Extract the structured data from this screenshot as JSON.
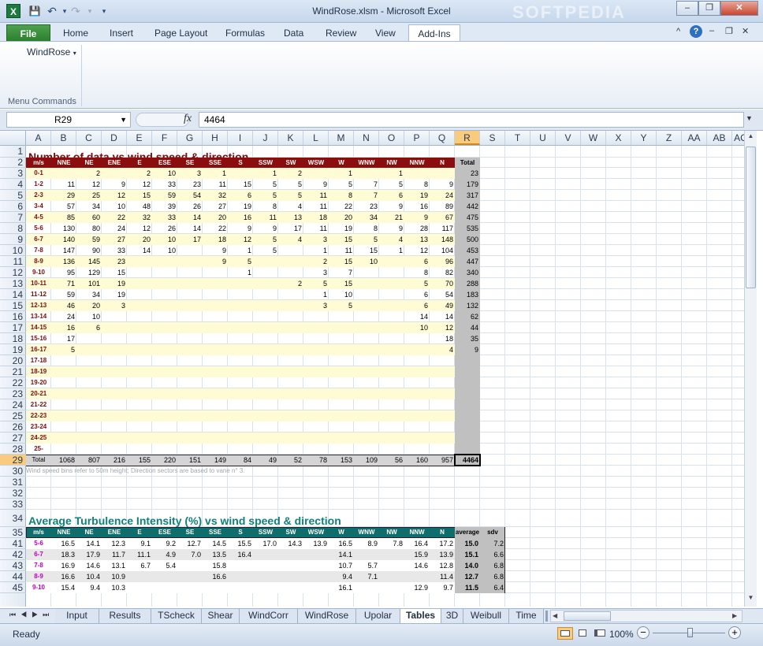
{
  "window": {
    "title": "WindRose.xlsm  -  Microsoft Excel",
    "minimize": "–",
    "restore": "❐",
    "close": "✕",
    "doc_min": "–",
    "doc_restore": "❐",
    "doc_close": "✕",
    "watermark": "SOFTPEDIA"
  },
  "quick_access": {
    "app_icon": "X",
    "save": "💾",
    "undo": "↶",
    "redo": "↷",
    "dropdown": "▾",
    "customize": "▾"
  },
  "ribbon": {
    "tabs": [
      "File",
      "Home",
      "Insert",
      "Page Layout",
      "Formulas",
      "Data",
      "Review",
      "View",
      "Add-Ins"
    ],
    "active_tab": "Add-Ins",
    "windrose_menu": "WindRose",
    "group_label": "Menu Commands",
    "collapse_icon": "^",
    "help_icon": "?"
  },
  "formula_bar": {
    "name_box": "R29",
    "fx": "fx",
    "value": "4464"
  },
  "columns": [
    "A",
    "B",
    "C",
    "D",
    "E",
    "F",
    "G",
    "H",
    "I",
    "J",
    "K",
    "L",
    "M",
    "N",
    "O",
    "P",
    "Q",
    "R",
    "S",
    "T",
    "U",
    "V",
    "W",
    "X",
    "Y",
    "Z",
    "AA",
    "AB",
    "AC"
  ],
  "selected_column": "R",
  "rows": [
    "1",
    "2",
    "3",
    "4",
    "5",
    "6",
    "7",
    "8",
    "9",
    "10",
    "11",
    "12",
    "13",
    "14",
    "15",
    "16",
    "17",
    "18",
    "19",
    "20",
    "21",
    "22",
    "23",
    "24",
    "25",
    "26",
    "27",
    "28",
    "29",
    "30",
    "31",
    "32",
    "33",
    "34",
    "35",
    "41",
    "42",
    "43",
    "44",
    "45"
  ],
  "selected_row": "29",
  "table1": {
    "title": "Number of data vs wind speed & direction",
    "headers": [
      "m/s",
      "NNE",
      "NE",
      "ENE",
      "E",
      "ESE",
      "SE",
      "SSE",
      "S",
      "SSW",
      "SW",
      "WSW",
      "W",
      "WNW",
      "NW",
      "NNW",
      "N",
      "Total"
    ],
    "rows": [
      [
        "0-1",
        "",
        "2",
        "",
        "2",
        "10",
        "3",
        "1",
        "",
        "1",
        "2",
        "",
        "1",
        "",
        "1",
        "",
        "",
        "23"
      ],
      [
        "1-2",
        "11",
        "12",
        "9",
        "12",
        "33",
        "23",
        "11",
        "15",
        "5",
        "5",
        "9",
        "5",
        "7",
        "5",
        "8",
        "9",
        "179"
      ],
      [
        "2-3",
        "29",
        "25",
        "12",
        "15",
        "59",
        "54",
        "32",
        "6",
        "5",
        "5",
        "11",
        "8",
        "7",
        "6",
        "19",
        "24",
        "317"
      ],
      [
        "3-4",
        "57",
        "34",
        "10",
        "48",
        "39",
        "26",
        "27",
        "19",
        "8",
        "4",
        "11",
        "22",
        "23",
        "9",
        "16",
        "89",
        "442"
      ],
      [
        "4-5",
        "85",
        "60",
        "22",
        "32",
        "33",
        "14",
        "20",
        "16",
        "11",
        "13",
        "18",
        "20",
        "34",
        "21",
        "9",
        "67",
        "475"
      ],
      [
        "5-6",
        "130",
        "80",
        "24",
        "12",
        "26",
        "14",
        "22",
        "9",
        "9",
        "17",
        "11",
        "19",
        "8",
        "9",
        "28",
        "117",
        "535"
      ],
      [
        "6-7",
        "140",
        "59",
        "27",
        "20",
        "10",
        "17",
        "18",
        "12",
        "5",
        "4",
        "3",
        "15",
        "5",
        "4",
        "13",
        "148",
        "500"
      ],
      [
        "7-8",
        "147",
        "90",
        "33",
        "14",
        "10",
        "",
        "9",
        "1",
        "5",
        "",
        "1",
        "11",
        "15",
        "1",
        "12",
        "104",
        "453"
      ],
      [
        "8-9",
        "136",
        "145",
        "23",
        "",
        "",
        "",
        "9",
        "5",
        "",
        "",
        "2",
        "15",
        "10",
        "",
        "6",
        "96",
        "447"
      ],
      [
        "9-10",
        "95",
        "129",
        "15",
        "",
        "",
        "",
        "",
        "1",
        "",
        "",
        "3",
        "7",
        "",
        "",
        "8",
        "82",
        "340"
      ],
      [
        "10-11",
        "71",
        "101",
        "19",
        "",
        "",
        "",
        "",
        "",
        "",
        "2",
        "5",
        "15",
        "",
        "",
        "5",
        "70",
        "288"
      ],
      [
        "11-12",
        "59",
        "34",
        "19",
        "",
        "",
        "",
        "",
        "",
        "",
        "",
        "1",
        "10",
        "",
        "",
        "6",
        "54",
        "183"
      ],
      [
        "12-13",
        "46",
        "20",
        "3",
        "",
        "",
        "",
        "",
        "",
        "",
        "",
        "3",
        "5",
        "",
        "",
        "6",
        "49",
        "132"
      ],
      [
        "13-14",
        "24",
        "10",
        "",
        "",
        "",
        "",
        "",
        "",
        "",
        "",
        "",
        "",
        "",
        "",
        "14",
        "14",
        "62"
      ],
      [
        "14-15",
        "16",
        "6",
        "",
        "",
        "",
        "",
        "",
        "",
        "",
        "",
        "",
        "",
        "",
        "",
        "10",
        "12",
        "44"
      ],
      [
        "15-16",
        "17",
        "",
        "",
        "",
        "",
        "",
        "",
        "",
        "",
        "",
        "",
        "",
        "",
        "",
        "",
        "18",
        "35"
      ],
      [
        "16-17",
        "5",
        "",
        "",
        "",
        "",
        "",
        "",
        "",
        "",
        "",
        "",
        "",
        "",
        "",
        "",
        "4",
        "9"
      ],
      [
        "17-18",
        "",
        "",
        "",
        "",
        "",
        "",
        "",
        "",
        "",
        "",
        "",
        "",
        "",
        "",
        "",
        "",
        ""
      ],
      [
        "18-19",
        "",
        "",
        "",
        "",
        "",
        "",
        "",
        "",
        "",
        "",
        "",
        "",
        "",
        "",
        "",
        "",
        ""
      ],
      [
        "19-20",
        "",
        "",
        "",
        "",
        "",
        "",
        "",
        "",
        "",
        "",
        "",
        "",
        "",
        "",
        "",
        "",
        ""
      ],
      [
        "20-21",
        "",
        "",
        "",
        "",
        "",
        "",
        "",
        "",
        "",
        "",
        "",
        "",
        "",
        "",
        "",
        "",
        ""
      ],
      [
        "21-22",
        "",
        "",
        "",
        "",
        "",
        "",
        "",
        "",
        "",
        "",
        "",
        "",
        "",
        "",
        "",
        "",
        ""
      ],
      [
        "22-23",
        "",
        "",
        "",
        "",
        "",
        "",
        "",
        "",
        "",
        "",
        "",
        "",
        "",
        "",
        "",
        "",
        ""
      ],
      [
        "23-24",
        "",
        "",
        "",
        "",
        "",
        "",
        "",
        "",
        "",
        "",
        "",
        "",
        "",
        "",
        "",
        "",
        ""
      ],
      [
        "24-25",
        "",
        "",
        "",
        "",
        "",
        "",
        "",
        "",
        "",
        "",
        "",
        "",
        "",
        "",
        "",
        "",
        ""
      ],
      [
        "25-",
        "",
        "",
        "",
        "",
        "",
        "",
        "",
        "",
        "",
        "",
        "",
        "",
        "",
        "",
        "",
        "",
        ""
      ]
    ],
    "totals": [
      "Total",
      "1068",
      "807",
      "216",
      "155",
      "220",
      "151",
      "149",
      "84",
      "49",
      "52",
      "78",
      "153",
      "109",
      "56",
      "160",
      "957",
      "4464"
    ],
    "note": "Wind speed bins refer to 50m height;  Direction sectors are based to vane n° 3."
  },
  "table2": {
    "title": "Average Turbulence Intensity (%) vs wind speed & direction",
    "headers": [
      "m/s",
      "NNE",
      "NE",
      "ENE",
      "E",
      "ESE",
      "SE",
      "SSE",
      "S",
      "SSW",
      "SW",
      "WSW",
      "W",
      "WNW",
      "NW",
      "NNW",
      "N",
      "average",
      "sdv"
    ],
    "rows": [
      [
        "5-6",
        "16.5",
        "14.1",
        "12.3",
        "9.1",
        "9.2",
        "12.7",
        "14.5",
        "15.5",
        "17.0",
        "14.3",
        "13.9",
        "16.5",
        "8.9",
        "7.8",
        "16.4",
        "17.2",
        "15.0",
        "7.2"
      ],
      [
        "6-7",
        "18.3",
        "17.9",
        "11.7",
        "11.1",
        "4.9",
        "7.0",
        "13.5",
        "16.4",
        "",
        "",
        "",
        "14.1",
        "",
        "",
        "15.9",
        "13.9",
        "15.1",
        "6.6"
      ],
      [
        "7-8",
        "16.9",
        "14.6",
        "13.1",
        "6.7",
        "5.4",
        "",
        "15.8",
        "",
        "",
        "",
        "",
        "10.7",
        "5.7",
        "",
        "14.6",
        "12.8",
        "14.0",
        "6.8"
      ],
      [
        "8-9",
        "16.6",
        "10.4",
        "10.9",
        "",
        "",
        "",
        "16.6",
        "",
        "",
        "",
        "",
        "9.4",
        "7.1",
        "",
        "",
        "11.4",
        "12.7",
        "6.8"
      ],
      [
        "9-10",
        "15.4",
        "9.4",
        "10.3",
        "",
        "",
        "",
        "",
        "",
        "",
        "",
        "",
        "16.1",
        "",
        "",
        "12.9",
        "9.7",
        "11.5",
        "6.4"
      ]
    ]
  },
  "sheet_tabs": [
    "Input",
    "Results",
    "TScheck",
    "Shear",
    "WindCorr",
    "WindRose",
    "Upolar",
    "Tables",
    "3D",
    "Weibull",
    "Time"
  ],
  "active_sheet": "Tables",
  "status": {
    "ready": "Ready",
    "zoom": "100%",
    "zoom_minus": "−",
    "zoom_plus": "+"
  },
  "colors": {
    "table1_header": "#8b0d0d",
    "table1_title": "#7a0e0e",
    "table2_header": "#0e6e6e",
    "table2_title": "#12807a",
    "band_yellow": "#fffbd5",
    "total_gray": "#c0c0c0"
  }
}
